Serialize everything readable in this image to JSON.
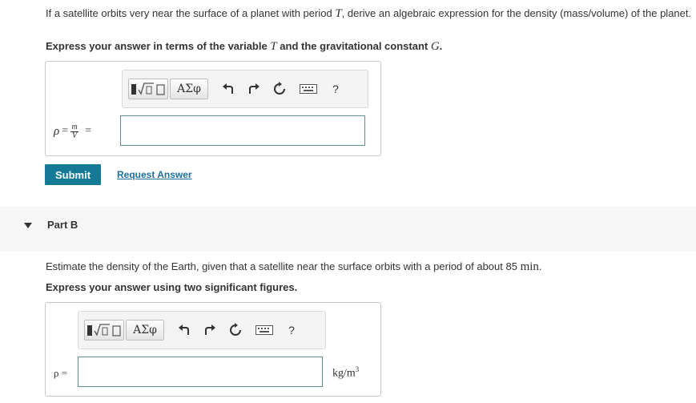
{
  "partA": {
    "question_prefix": "If a satellite orbits very near the surface of a planet with period ",
    "question_var": "T",
    "question_suffix": ", derive an algebraic expression for the density (mass/volume) of the planet.",
    "instruction_prefix": "Express your answer in terms of the variable ",
    "instruction_var1": "T",
    "instruction_mid": " and the gravitational constant ",
    "instruction_var2": "G",
    "instruction_end": ".",
    "lhs_rho": "ρ",
    "lhs_eq1": "=",
    "lhs_num": "m",
    "lhs_den": "V",
    "lhs_eq2": "=",
    "answer_value": "",
    "submit_label": "Submit",
    "request_label": "Request Answer"
  },
  "toolbar": {
    "greek_label": "ΑΣφ",
    "help_label": "?"
  },
  "partB": {
    "title": "Part B",
    "question_prefix": "Estimate the density of the Earth, given that a satellite near the surface orbits with a period of about 85 ",
    "question_unit": "min",
    "question_end": ".",
    "instruction": "Express your answer using two significant figures.",
    "lhs": "ρ =",
    "answer_value": "",
    "unit_base": "kg/m",
    "unit_exp": "3"
  }
}
